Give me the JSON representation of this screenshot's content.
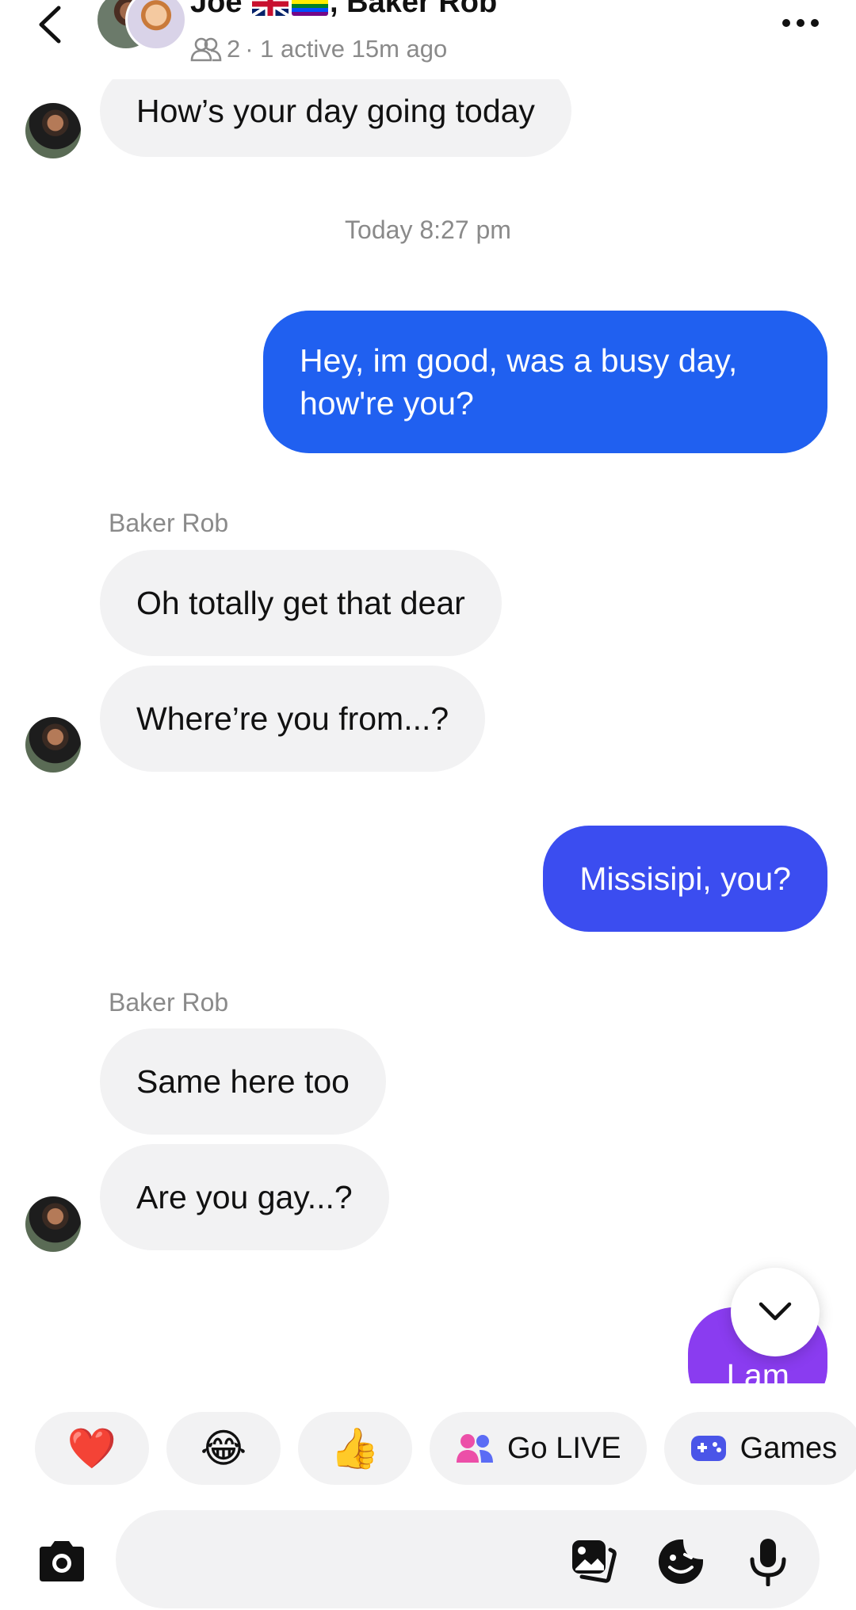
{
  "header": {
    "title_prefix": "Joe",
    "title_suffix": ", Baker Rob",
    "member_count": "2",
    "status": "· 1 active 15m ago",
    "icons": [
      "back-chevron-icon",
      "group-people-icon",
      "more-dots-icon"
    ]
  },
  "messages": {
    "m0": "How’s your day going today",
    "timestamp": "Today 8:27 pm",
    "m1_line1": "Hey, im good, was a busy day,",
    "m1_line2": "how're you?",
    "sender1": "Baker Rob",
    "m2": "Oh totally get that dear",
    "m3": "Where’re you from...?",
    "m4": "Missisipi, you?",
    "sender2": "Baker Rob",
    "m5": "Same here too",
    "m6": "Are you gay...?",
    "m7": "I am"
  },
  "quick_actions": {
    "heart": "❤️",
    "laugh": "😂",
    "thumbs": "👍",
    "go_live": "Go LIVE",
    "games": "Games"
  },
  "composer": {
    "placeholder": "",
    "icons": [
      "camera-icon",
      "gallery-icon",
      "sticker-icon",
      "microphone-icon"
    ]
  },
  "colors": {
    "outgoing_blue": "#2060f0",
    "outgoing_indigo": "#3b4df0",
    "outgoing_purple": "#8a3cf0",
    "incoming_bg": "#f2f2f3",
    "secondary_text": "#8a8a8a"
  }
}
